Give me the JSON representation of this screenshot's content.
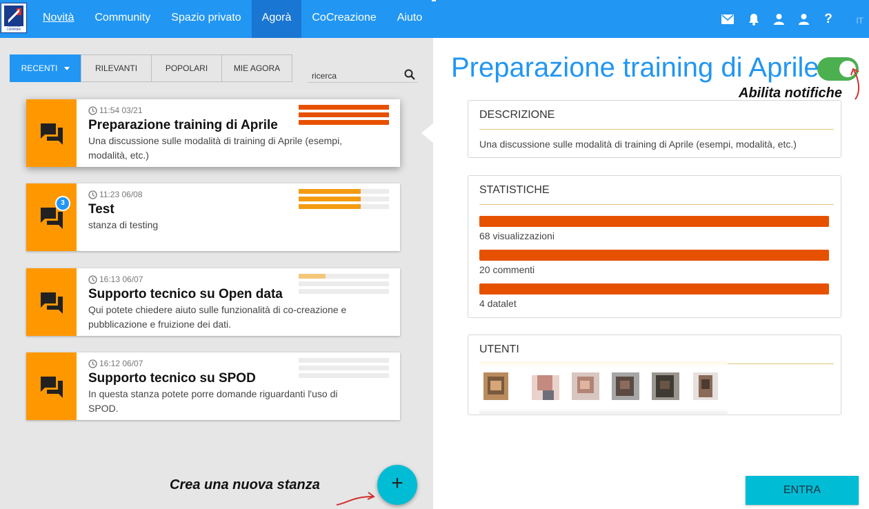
{
  "nav": {
    "logo_caption": "REGIONE CAMPANIA",
    "items": [
      {
        "label": "Novità"
      },
      {
        "label": "Community"
      },
      {
        "label": "Spazio privato"
      },
      {
        "label": "Agorà"
      },
      {
        "label": "CoCreazione"
      },
      {
        "label": "Aiuto"
      }
    ],
    "active_item": "Agorà",
    "icons": [
      "mail-icon",
      "bell-icon",
      "user-icon",
      "user-icon",
      "help-icon"
    ],
    "help_label": "?",
    "language": "IT"
  },
  "tabs": [
    {
      "label": "RECENTI",
      "active": true
    },
    {
      "label": "RILEVANTI"
    },
    {
      "label": "POPOLARI"
    },
    {
      "label": "MIE AGORA"
    }
  ],
  "search": {
    "placeholder": "ricerca"
  },
  "rooms": [
    {
      "time": "11:54 03/21",
      "title": "Preparazione training di Aprile",
      "description": "Una discussione sulle modalità di training di Aprile (esempi, modalità, etc.)",
      "selected": true,
      "activity_levels": [
        1.0,
        1.0,
        1.0
      ]
    },
    {
      "time": "11:23 06/08",
      "title": "Test",
      "description": "stanza di testing",
      "badge": "3",
      "activity_levels": [
        0.69,
        0.69,
        0.69
      ]
    },
    {
      "time": "16:13 06/07",
      "title": "Supporto tecnico su Open data",
      "description": "Qui potete chiedere aiuto sulle funzionalità di co-creazione e pubblicazione e fruizione dei dati.",
      "activity_levels": [
        0.3,
        0.0,
        0.0
      ]
    },
    {
      "time": "16:12 06/07",
      "title": "Supporto tecnico su SPOD",
      "description": "In questa stanza potete porre domande riguardanti l'uso di SPOD.",
      "activity_levels": [
        0.0,
        0.0,
        0.0
      ]
    }
  ],
  "create_hint": "Crea una nuova stanza",
  "fab_label": "+",
  "detail": {
    "title": "Preparazione training di Aprile",
    "notify_toggle_on": true,
    "notify_hint": "Abilita notifiche",
    "description_heading": "DESCRIZIONE",
    "description": "Una discussione sulle modalità di training di Aprile (esempi, modalità, etc.)",
    "stats_heading": "STATISTICHE",
    "stats": [
      {
        "label": "68 visualizzazioni",
        "level": 1.0
      },
      {
        "label": "20 commenti",
        "level": 1.0
      },
      {
        "label": "4 datalet",
        "level": 1.0
      }
    ],
    "users_heading": "UTENTI",
    "user_count": 6,
    "enter_label": "ENTRA"
  },
  "colors": {
    "nav_blue": "#2196f3",
    "accent_orange": "#ff9800",
    "stat_orange": "#e65100",
    "toggle_green": "#4caf50",
    "cyan": "#00bcd4"
  }
}
